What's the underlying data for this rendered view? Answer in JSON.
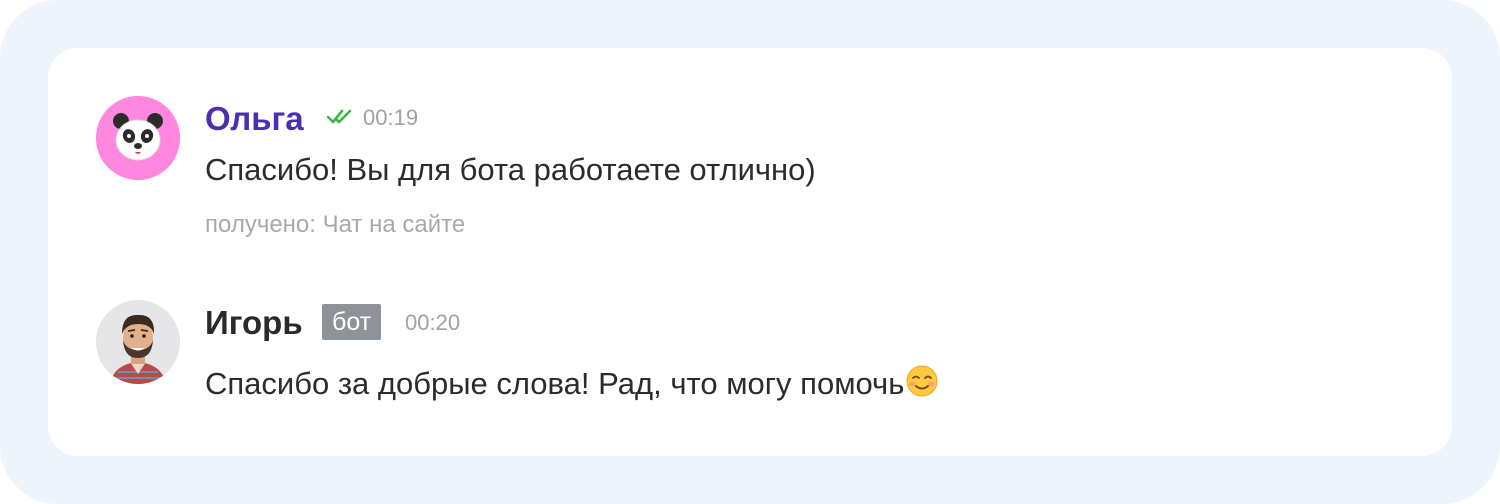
{
  "messages": [
    {
      "author": "Ольга",
      "time": "00:19",
      "text": "Спасибо! Вы для бота работаете отлично)",
      "source": "получено: Чат на сайте",
      "status_icon": "double-check-icon",
      "avatar_icon": "panda-icon",
      "avatar_bg": "#FF87DE",
      "name_color": "#4B2FB0"
    },
    {
      "author": "Игорь",
      "badge": "бот",
      "time": "00:20",
      "text": "Спасибо за добрые слова! Рад, что могу помочь",
      "emoji_icon": "smiling-face-icon",
      "avatar_icon": "man-photo-avatar"
    }
  ],
  "colors": {
    "frame": "#EEF4FC",
    "card": "#FFFFFF",
    "read_ticks": "#3BB54A",
    "badge_bg": "#8E9399",
    "muted_text": "#9DA2A8"
  }
}
